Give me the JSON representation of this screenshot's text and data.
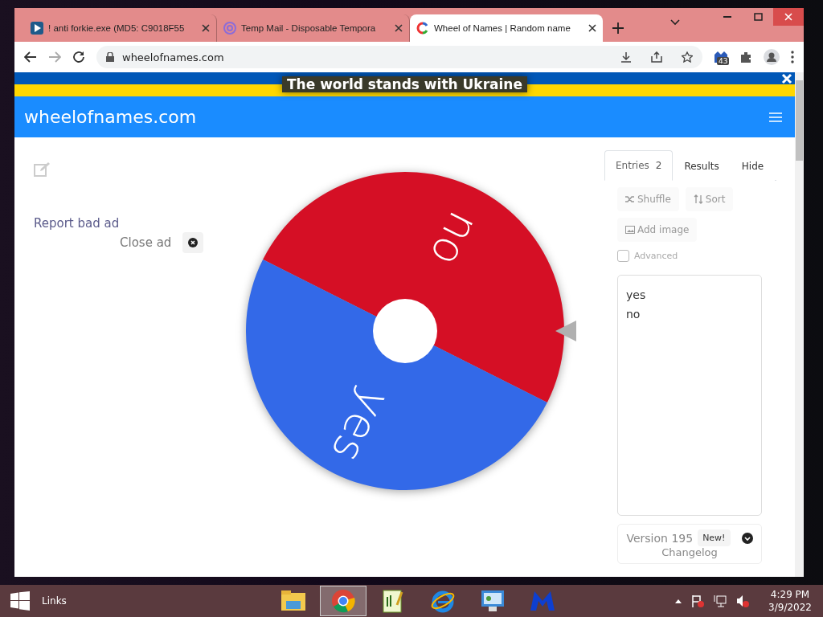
{
  "browser": {
    "tabs": [
      {
        "title": "! anti forkie.exe (MD5: C9018F55",
        "selected": false,
        "kind": "play"
      },
      {
        "title": "Temp Mail - Disposable Tempora",
        "selected": false,
        "kind": "at"
      },
      {
        "title": "Wheel of Names | Random name",
        "selected": true,
        "kind": "wheel"
      }
    ],
    "address": "wheelofnames.com",
    "extension_badge": "43"
  },
  "banner": {
    "text": "The world stands with Ukraine"
  },
  "header": {
    "brand": "wheelofnames.com"
  },
  "ad": {
    "report": "Report bad ad",
    "close": "Close ad"
  },
  "wheel": {
    "segments": [
      {
        "label": "no",
        "color": "#d50f25"
      },
      {
        "label": "yes",
        "color": "#3369e8"
      }
    ]
  },
  "panel": {
    "tabs": [
      {
        "label": "Entries",
        "badge": "2",
        "selected": true
      },
      {
        "label": "Results",
        "selected": false
      },
      {
        "label": "Hide",
        "selected": false
      }
    ],
    "buttons": [
      {
        "label": "Shuffle",
        "kind": "shuffle"
      },
      {
        "label": "Sort",
        "kind": "sort"
      },
      {
        "label": "Add image",
        "kind": "image"
      }
    ],
    "advanced": {
      "label": "Advanced",
      "checked": false
    },
    "entries": "yes\nno",
    "version": {
      "text": "Version 195",
      "badge": "New!",
      "link": "Changelog"
    }
  },
  "taskbar": {
    "links": "Links",
    "apps": [
      {
        "kind": "folder",
        "selected": false
      },
      {
        "kind": "chrome",
        "selected": true
      },
      {
        "kind": "notepad",
        "selected": false
      },
      {
        "kind": "ie",
        "selected": false
      },
      {
        "kind": "panel",
        "selected": false
      },
      {
        "kind": "m",
        "selected": false
      }
    ],
    "time": "4:29 PM",
    "date": "3/9/2022"
  }
}
